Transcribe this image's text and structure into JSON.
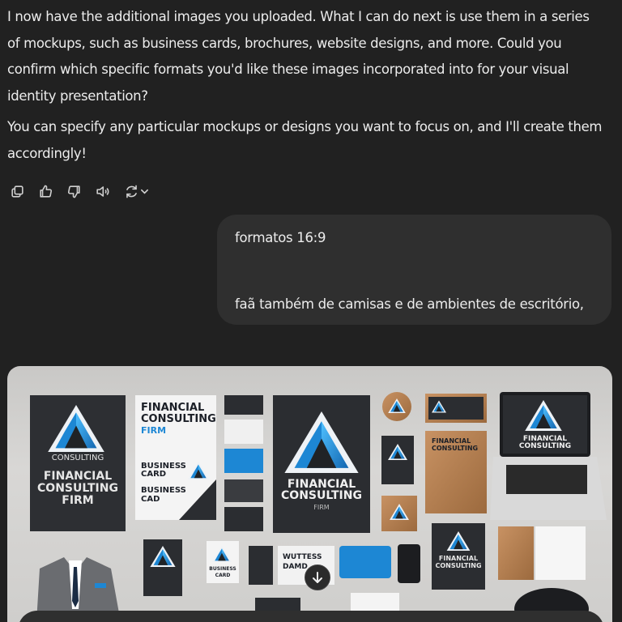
{
  "assistant": {
    "paragraph1": "I now have the additional images you uploaded. What I can do next is use them in a series of mockups, such as business cards, brochures, website designs, and more. Could you confirm which specific formats you'd like these images incorporated into for your visual identity presentation?",
    "paragraph2": "You can specify any particular mockups or designs you want to focus on, and I'll create them accordingly!"
  },
  "actions": [
    {
      "icon": "copy-icon"
    },
    {
      "icon": "thumbs-up-icon"
    },
    {
      "icon": "thumbs-down-icon"
    },
    {
      "icon": "read-aloud-icon"
    },
    {
      "icon": "regenerate-icon"
    }
  ],
  "user": {
    "line1": "formatos 16:9",
    "line2": "faã também de camisas e de ambientes de escritório,"
  },
  "image": {
    "poster_left": {
      "top": "CONSULTING",
      "title_l1": "FINANCIAL",
      "title_l2": "CONSULTING",
      "title_l3": "FIRM"
    },
    "flyer": {
      "title_l1": "FINANCIAL",
      "title_l2": "CONSULTING",
      "title_l3": "FIRM",
      "item1_l1": "BUSINESS",
      "item1_l2": "CARD",
      "item2_l1": "BUSINESS",
      "item2_l2": "CAD"
    },
    "poster_center": {
      "title_l1": "FINANCIAL",
      "title_l2": "CONSULTING",
      "title_l3": "FIRM"
    },
    "card_right": {
      "title_l1": "FINANCIAL",
      "title_l2": "CONSULTING"
    },
    "laptop": {
      "title_l1": "FINANCIAL",
      "title_l2": "CONSULTING"
    },
    "book": {
      "title_l1": "FINANCIAL",
      "title_l2": "CONSULTING"
    },
    "bottom_card": {
      "l1": "BUSINESS",
      "l2": "CARD"
    },
    "bottom_card2": {
      "l1": "WUTTESS",
      "l2": "DAMD"
    },
    "bottom_poster": {
      "l1": "FINANCIAL",
      "l2": "CONSULTING"
    },
    "colors": {
      "accent_blue": "#1e9be0",
      "navy": "#1b2c44",
      "dark": "#2b2d31",
      "wood": "#b98253"
    }
  }
}
